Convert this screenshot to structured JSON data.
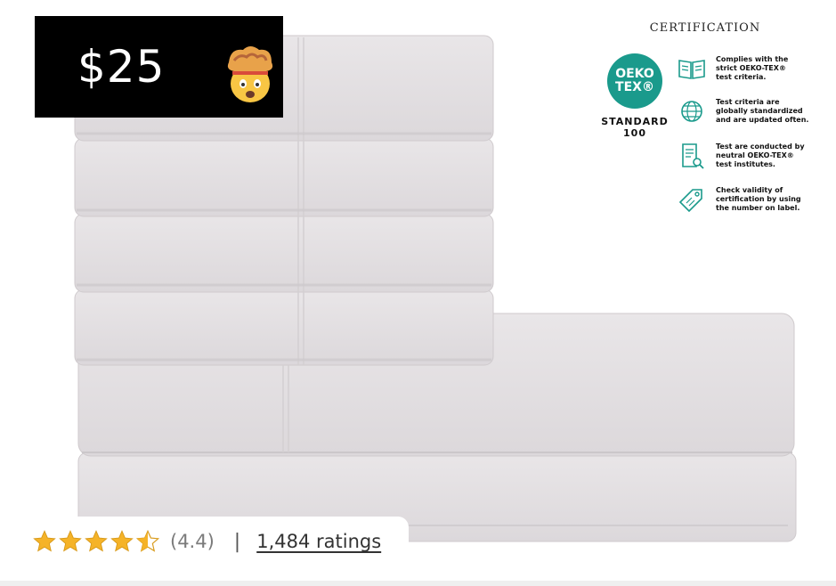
{
  "price": {
    "label": "$25"
  },
  "certification": {
    "title": "CERTIFICATION",
    "logo_line1": "OEKO",
    "logo_line2": "TEX®",
    "standard_line1": "STANDARD",
    "standard_line2": "100",
    "logo_color": "#1a9a8c",
    "features": [
      {
        "icon": "open-book-icon",
        "lines": [
          "Complies with the",
          "strict OEKO-TEX®",
          "test criteria."
        ]
      },
      {
        "icon": "globe-icon",
        "lines": [
          "Test criteria are",
          "globally standardized",
          "and are updated often."
        ]
      },
      {
        "icon": "document-search-icon",
        "lines": [
          "Test are conducted by",
          "neutral OEKO-TEX®",
          "test institutes."
        ]
      },
      {
        "icon": "tag-icon",
        "lines": [
          "Check validity of",
          "certification by using",
          "the number on label."
        ]
      }
    ]
  },
  "rating": {
    "stars": 4.4,
    "value_text": "(4.4)",
    "separator": "|",
    "count_text": "1,484 ratings",
    "star_color": "#f5b328"
  }
}
